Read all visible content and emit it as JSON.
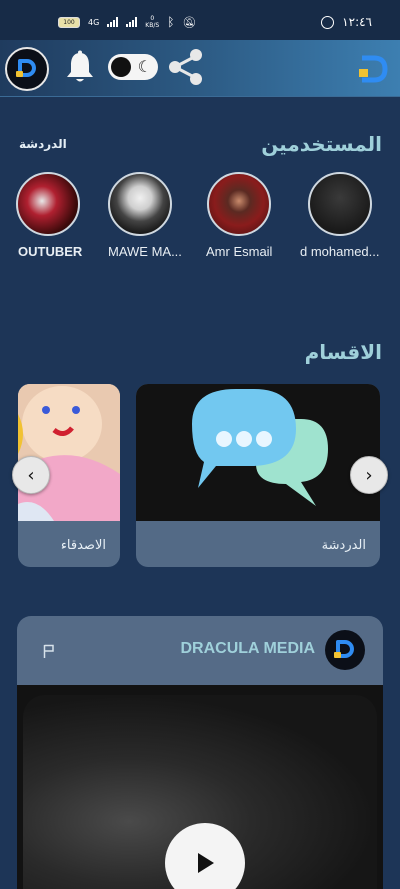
{
  "status_bar": {
    "battery": "100",
    "network": "4G",
    "speed_value": "0",
    "speed_unit": "KB/S",
    "time": "١٢:٤٦"
  },
  "app_bar": {
    "icons": [
      "app-logo-icon",
      "bell-icon",
      "dark-mode-toggle",
      "share-icon",
      "brand-logo-icon"
    ]
  },
  "users": {
    "title": "المستخدمين",
    "link": "الدردشة",
    "items": [
      {
        "name": "d mohamed..."
      },
      {
        "name": "Amr Esmail"
      },
      {
        "name": "MAWE MA..."
      },
      {
        "name": "OUTUBER"
      }
    ]
  },
  "categories": {
    "title": "الاقسام",
    "items": [
      {
        "label": "الدردشة"
      },
      {
        "label": "الاصدقاء"
      }
    ]
  },
  "post": {
    "author": "DRACULA MEDIA"
  },
  "colors": {
    "background": "#1d3557",
    "accent": "#9fd0da",
    "card": "#556b87"
  }
}
